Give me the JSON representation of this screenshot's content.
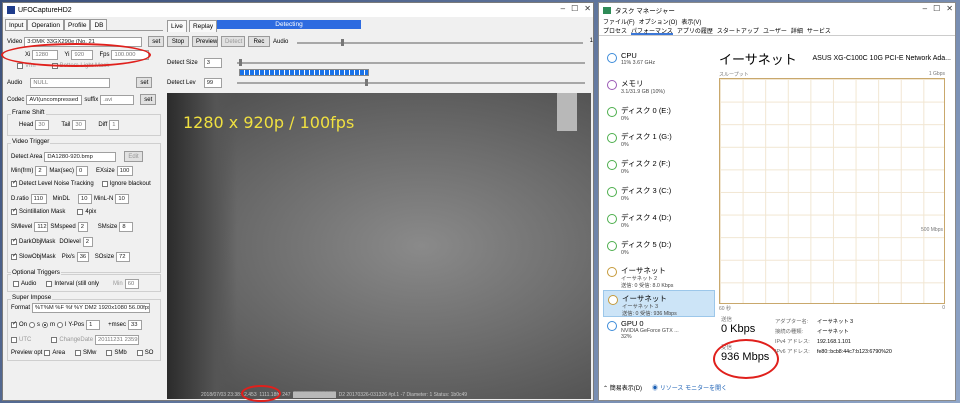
{
  "ufo": {
    "title": "UFOCaptureHD2",
    "tabs": [
      "Input",
      "Operation",
      "Profile",
      "DB"
    ],
    "video_label": "Video",
    "video_device": "3:DMK 33GX290e (No. 21",
    "set_label": "set",
    "xi_label": "Xi",
    "xi_value": "1280",
    "yi_label": "Yi",
    "yi_value": "920",
    "fps_label": "Fps",
    "fps_value": "100.000",
    "vfm_label": "Vfm",
    "bottom_light_label": "Bottom Light Mask",
    "audio_label": "Audio",
    "audio_value": "NULL",
    "codec_label": "Codec",
    "codec_value": "AVI(uncompressed",
    "suffix_label": "suffix",
    "suffix_value": ".avi",
    "frame_shift_label": "Frame Shift",
    "head_label": "Head",
    "head_value": "30",
    "tail_label": "Tail",
    "tail_value": "30",
    "diff_label": "Diff",
    "diff_value": "1",
    "video_trigger_label": "Video Trigger",
    "detect_area_label": "Detect Area",
    "detect_area_value": "DA1280-920.bmp",
    "edit_label": "Edit",
    "min_frm_label": "Min(frm)",
    "min_frm_value": "2",
    "max_sec_label": "Max(sec)",
    "max_sec_value": "0",
    "exsize_label": "EXsize",
    "exsize_value": "100",
    "dlnt_label": "Detect Level Noise Tracking",
    "ignore_blackout_label": "Ignore blackout",
    "dratio_label": "D.ratio",
    "dratio_value": "110",
    "mindl_label": "MinDL",
    "mindl_value": "10",
    "minlm_label": "MinL-N",
    "minlm_value": "10",
    "scint_label": "Scintillation Mask",
    "fourpix_label": "4pix",
    "slevel_label": "SMlevel",
    "slevel_value": "112",
    "smspeed_label": "SMspeed",
    "smspeed_value": "2",
    "smsize_label": "SMsize",
    "smsize_value": "8",
    "darkobj_label": "DarkObjMask",
    "dolevel_label": "DOlevel",
    "dolevel_value": "2",
    "slowobj_label": "SlowObjMask",
    "pixs_label": "Pix/s",
    "pixs_value": "36",
    "sosize_label": "SOsize",
    "sosize_value": "72",
    "optional_triggers_label": "Optional Triggers",
    "opt_audio_label": "Audio",
    "interval_label": "Interval (still only",
    "min_label": "Min",
    "min_value": "60",
    "super_impose_label": "Super Impose",
    "format_label": "Format",
    "format_value": "%T%M %F %f %Y  DM2 1920x1080 56.00fps",
    "on_label": "On",
    "s_label": "s",
    "m_label": "m",
    "l_label": "l",
    "ypos_label": "Y-Pos",
    "ypos_value": "1",
    "msec_label": "+msec",
    "msec_value": "33",
    "utc_label": "UTC",
    "change_date_label": "ChangeDate",
    "change_date_value": "20111231 235959",
    "preview_opt_label": "Preview opt",
    "area_label": "Area",
    "smw_label": "SMw",
    "smb_label": "SMb",
    "so_label": "SO",
    "live_tab": "Live",
    "replay_tab": "Replay",
    "detecting_label": "Detecting",
    "stop_label": "Stop",
    "preview_label": "Preview",
    "detect_btn_label": "Detect",
    "rec_label": "Rec",
    "audio_right_label": "Audio",
    "one_label": "1",
    "detect_size_label": "Detect Size",
    "detect_size_value": "3",
    "detect_lev_label": "Detect Lev",
    "detect_lev_value": "99",
    "video_overlay": "1280 x 920p / 100fps",
    "status_left": "2018/07/03 23:38:12.453",
    "status_mid": "1111.18fr",
    "status_mid2": "247",
    "status_right": "D2 20170326-031326 #pl.1 -7 Diameter: 1 Status: 1b0c49"
  },
  "tm": {
    "title": "タスク マネージャー",
    "menu": [
      "ファイル(F)",
      "オプション(O)",
      "表示(V)"
    ],
    "tabs": [
      "プロセス",
      "パフォーマンス",
      "アプリの履歴",
      "スタートアップ",
      "ユーザー",
      "詳細",
      "サービス"
    ],
    "items": [
      {
        "name": "CPU",
        "line1": "11%  3.67 GHz",
        "line2": "",
        "kind": "cpu"
      },
      {
        "name": "メモリ",
        "line1": "3.1/31.9 GB (10%)",
        "line2": "",
        "kind": "mem"
      },
      {
        "name": "ディスク 0 (E:)",
        "line1": "0%",
        "line2": "",
        "kind": "disk"
      },
      {
        "name": "ディスク 1 (G:)",
        "line1": "0%",
        "line2": "",
        "kind": "disk"
      },
      {
        "name": "ディスク 2 (F:)",
        "line1": "0%",
        "line2": "",
        "kind": "disk"
      },
      {
        "name": "ディスク 3 (C:)",
        "line1": "0%",
        "line2": "",
        "kind": "disk"
      },
      {
        "name": "ディスク 4 (D:)",
        "line1": "0%",
        "line2": "",
        "kind": "disk"
      },
      {
        "name": "ディスク 5 (D:)",
        "line1": "0%",
        "line2": "",
        "kind": "disk"
      },
      {
        "name": "イーサネット",
        "line1": "イーサネット 2",
        "line2": "送信: 0 受信: 8.0 Kbps",
        "kind": "net"
      },
      {
        "name": "イーサネット",
        "line1": "イーサネット 3",
        "line2": "送信: 0 受信: 936 Mbps",
        "kind": "net"
      },
      {
        "name": "GPU 0",
        "line1": "NVIDIA GeForce GTX ...",
        "line2": "32%",
        "kind": "gpu"
      }
    ],
    "main_title": "イーサネット",
    "adapter": "ASUS XG-C100C 10G PCI-E Network Ada...",
    "throughput_label": "スループット",
    "graph_max": "1 Gbps",
    "graph_mid": "500 Mbps",
    "graph_time": "60 秒",
    "graph_zero": "0",
    "send_label": "送信",
    "send_value": "0 Kbps",
    "recv_label": "受信",
    "recv_value": "936 Mbps",
    "adapter_name_label": "アダプター名:",
    "adapter_name_value": "イーサネット 3",
    "conn_type_label": "接続の種類:",
    "conn_type_value": "イーサネット",
    "ipv4_label": "IPv4 アドレス:",
    "ipv4_value": "192.168.1.101",
    "ipv6_label": "IPv6 アドレス:",
    "ipv6_value": "fe80::bcb8:44c7:b123:6790%20",
    "brief_label": "簡易表示(D)",
    "resmon_label": "リソース モニターを開く"
  }
}
